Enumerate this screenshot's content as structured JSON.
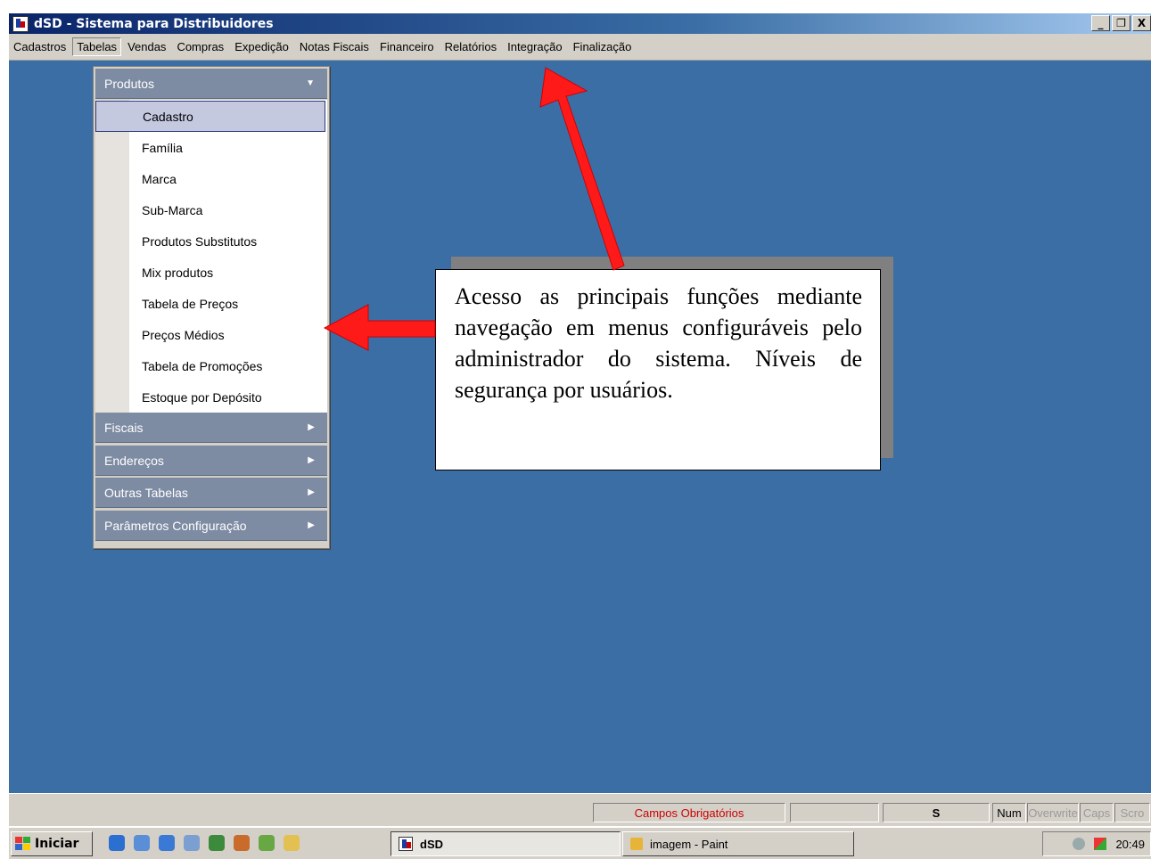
{
  "window": {
    "title": "dSD - Sistema para Distribuidores",
    "icon": "dsd-app-icon",
    "buttons": [
      "_",
      "ȅ",
      "X"
    ]
  },
  "menubar": {
    "items": [
      {
        "label": "Cadastros"
      },
      {
        "label": "Tabelas"
      },
      {
        "label": "Vendas"
      },
      {
        "label": "Compras"
      },
      {
        "label": "Expedição"
      },
      {
        "label": "Notas Fiscais"
      },
      {
        "label": "Financeiro"
      },
      {
        "label": "Relatórios"
      },
      {
        "label": "Integração"
      },
      {
        "label": "Finalização"
      }
    ],
    "active_item": "Tabelas"
  },
  "dropdown": {
    "groups": [
      {
        "label": "Produtos",
        "expanded": true
      },
      {
        "label": "Fiscais"
      },
      {
        "label": "Endereços"
      },
      {
        "label": "Outras Tabelas"
      },
      {
        "label": "Parâmetros Configuração"
      }
    ],
    "submenu_items": [
      {
        "label": "Cadastro",
        "selected": true
      },
      {
        "label": "Família"
      },
      {
        "label": "Marca"
      },
      {
        "label": "Sub-Marca"
      },
      {
        "label": "Produtos Substitutos"
      },
      {
        "label": "Mix produtos"
      },
      {
        "label": "Tabela de Preços"
      },
      {
        "label": "Preços Médios"
      },
      {
        "label": "Tabela de Promoções"
      },
      {
        "label": "Estoque por Depósito"
      }
    ]
  },
  "callout": {
    "text": "Acesso as principais funções mediante navegação em menus configuráveis pelo administrador do sistema. Níveis de segurança por usuários.",
    "arrow_color": "#ff0000"
  },
  "statusbar": {
    "required_fields": "Campos Obrigatórios",
    "required_color": "#cc0000",
    "indicator_s": "S",
    "num": "Num",
    "overwrite": "Overwrite",
    "caps": "Caps",
    "scroll": "Scro"
  },
  "taskbar": {
    "start_label": "Iniciar",
    "quick_launch_icons": [
      "ie-icon",
      "outlook-icon",
      "web-icon",
      "media-icon",
      "speaker-icon",
      "java-icon",
      "network-icon",
      "folder-icon"
    ],
    "tasks": [
      {
        "label": "dSD",
        "icon": "dsd-app-icon",
        "active": true
      },
      {
        "label": "imagem - Paint",
        "icon": "paint-icon",
        "active": false
      }
    ],
    "clock": "20:49"
  }
}
